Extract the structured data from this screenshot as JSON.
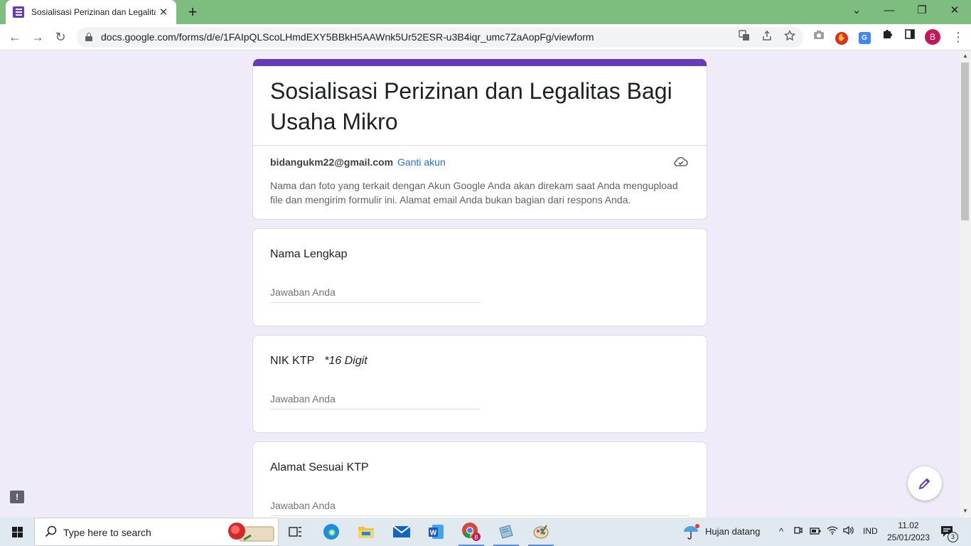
{
  "browser": {
    "tab": {
      "title": "Sosialisasi Perizinan dan Legalitas Bagi Usaha Mikro",
      "close_glyph": "✕"
    },
    "new_tab_glyph": "+",
    "window_controls": {
      "collapse": "⌄",
      "minimize": "—",
      "restore": "❐",
      "close": "✕"
    },
    "nav": {
      "back": "←",
      "forward": "→",
      "reload": "↻"
    },
    "url": "docs.google.com/forms/d/e/1FAIpQLScoLHmdEXY5BBkH5AAWnk5Ur52ESR-u3B4iqr_umc7ZaAopFg/viewform",
    "omnibox_icons": [
      "translate-icon",
      "share-icon",
      "bookmark-star-icon"
    ],
    "extensions": [
      "camera-icon",
      "stop-extension-icon",
      "translate-extension-icon",
      "puzzle-icon",
      "sidepanel-icon"
    ],
    "profile_initial": "B",
    "menu_glyph": "⋮"
  },
  "form": {
    "accent_color": "#673ab7",
    "background_color": "#f0ebf8",
    "title": "Sosialisasi Perizinan dan Legalitas Bagi Usaha Mikro",
    "account": {
      "email": "bidangukm22@gmail.com",
      "switch_label": "Ganti akun"
    },
    "notice": "Nama dan foto yang terkait dengan Akun Google Anda akan direkam saat Anda mengupload file dan mengirim formulir ini. Alamat email Anda bukan bagian dari respons Anda.",
    "questions": [
      {
        "label": "Nama Lengkap",
        "hint": "",
        "placeholder": "Jawaban Anda"
      },
      {
        "label": "NIK KTP",
        "hint": "*16 Digit",
        "placeholder": "Jawaban Anda"
      },
      {
        "label": "Alamat Sesuai KTP",
        "hint": "",
        "placeholder": "Jawaban Anda"
      }
    ],
    "support_glyph": "!"
  },
  "taskbar": {
    "search_placeholder": "Type here to search",
    "apps": [
      "task-view-icon",
      "edge-icon",
      "file-explorer-icon",
      "mail-icon",
      "word-icon",
      "chrome-icon",
      "notepad-app-icon",
      "paint-icon"
    ],
    "weather": "Hujan datang",
    "tray_chevron": "^",
    "language": "IND",
    "time": "11.02",
    "date": "25/01/2023",
    "notification_count": "3"
  }
}
